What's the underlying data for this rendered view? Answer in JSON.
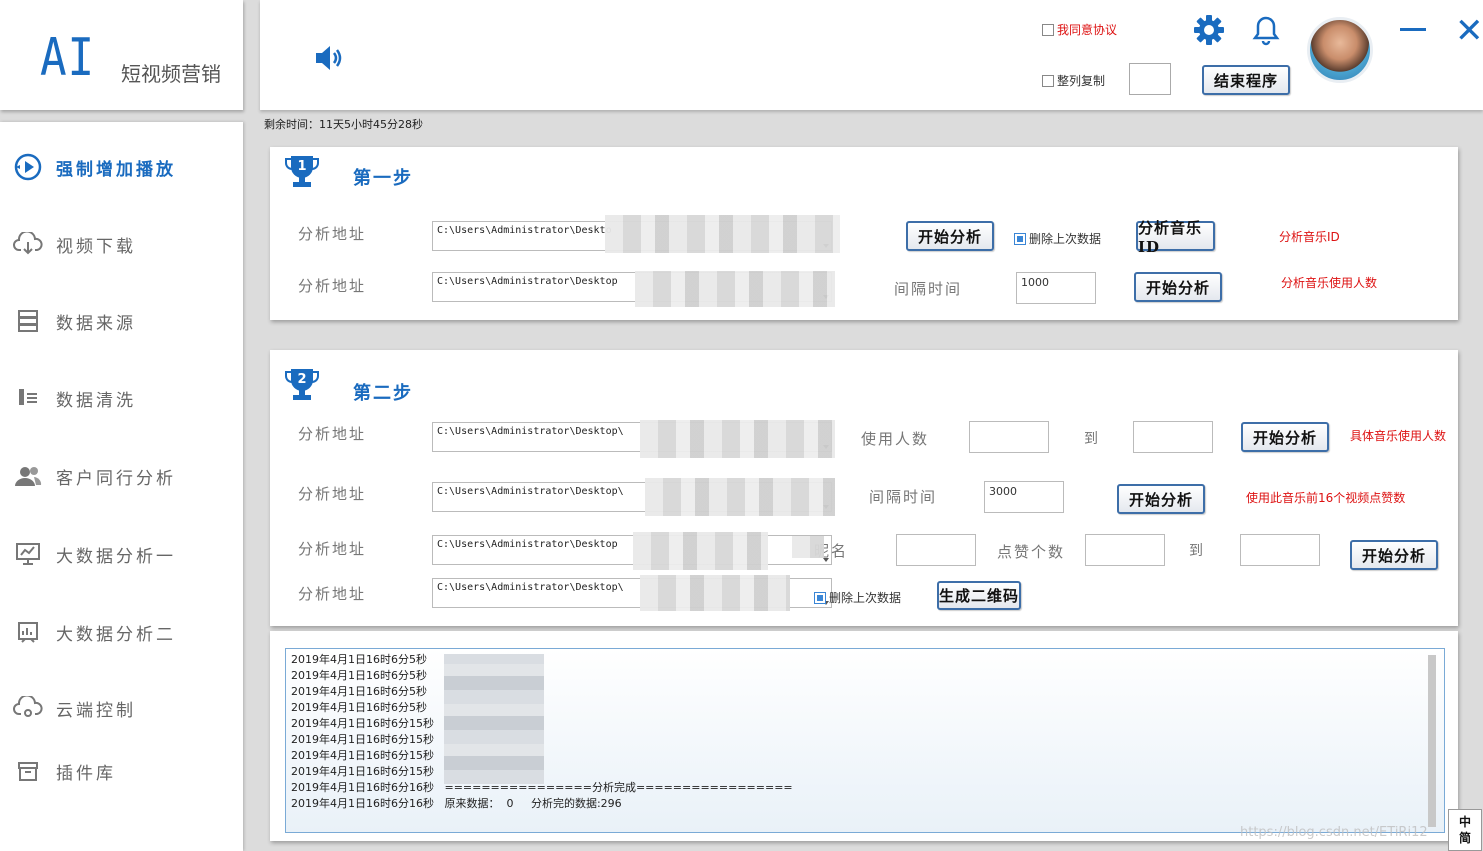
{
  "logo": {
    "ai": "AI",
    "subtitle": "短视频营销"
  },
  "sidebar": {
    "items": [
      {
        "label": "强制增加播放",
        "icon": "play-circle-icon",
        "active": true
      },
      {
        "label": "视频下载",
        "icon": "cloud-download-icon"
      },
      {
        "label": "数据来源",
        "icon": "database-icon"
      },
      {
        "label": "数据清洗",
        "icon": "data-clean-icon"
      },
      {
        "label": "客户同行分析",
        "icon": "users-icon"
      },
      {
        "label": "大数据分析一",
        "icon": "monitor-chart-icon"
      },
      {
        "label": "大数据分析二",
        "icon": "board-chart-icon"
      },
      {
        "label": "云端控制",
        "icon": "cloud-control-icon"
      },
      {
        "label": "插件库",
        "icon": "archive-icon"
      }
    ]
  },
  "header": {
    "agree_label": "我同意协议",
    "copy_label": "整列复制",
    "end_button": "结束程序"
  },
  "remaining_time": "剩余时间：11天5小时45分28秒",
  "step1": {
    "title": "第一步",
    "badge": "1",
    "row1": {
      "label": "分析地址",
      "path": "C:\\Users\\Administrator\\Deskto",
      "btn": "开始分析",
      "delete_label": "删除上次数据",
      "btn2": "分析音乐ID",
      "hint": "分析音乐ID"
    },
    "row2": {
      "label": "分析地址",
      "path": "C:\\Users\\Administrator\\Desktop",
      "interval_label": "间隔时间",
      "interval_value": "1000",
      "btn": "开始分析",
      "hint": "分析音乐使用人数"
    }
  },
  "step2": {
    "title": "第二步",
    "badge": "2",
    "row1": {
      "label": "分析地址",
      "path": "C:\\Users\\Administrator\\Desktop\\",
      "users_label": "使用人数",
      "to": "到",
      "btn": "开始分析",
      "hint": "具体音乐使用人数"
    },
    "row2": {
      "label": "分析地址",
      "path": "C:\\Users\\Administrator\\Desktop\\",
      "interval_label": "间隔时间",
      "interval_value": "3000",
      "btn": "开始分析",
      "hint": "使用此音乐前16个视频点赞数"
    },
    "row3": {
      "label": "分析地址",
      "path": "C:\\Users\\Administrator\\Desktop",
      "name_label": "昵名",
      "likes_label": "点赞个数",
      "to": "到",
      "btn": "开始分析"
    },
    "row4": {
      "label": "分析地址",
      "path": "C:\\Users\\Administrator\\Desktop\\",
      "delete_label": "删除上次数据",
      "btn": "生成二维码"
    }
  },
  "log": {
    "lines": [
      "2019年4月1日16时6分5秒",
      "2019年4月1日16时6分5秒",
      "2019年4月1日16时6分5秒",
      "2019年4月1日16时6分5秒",
      "2019年4月1日16时6分15秒",
      "2019年4月1日16时6分15秒",
      "2019年4月1日16时6分15秒",
      "2019年4月1日16时6分15秒",
      "2019年4月1日16时6分16秒   ================分析完成=================",
      "2019年4月1日16时6分16秒   原来数据：  0     分析完的数据:296"
    ]
  },
  "ime": {
    "top": "中",
    "bottom": "简"
  },
  "watermark": "https://blog.csdn.net/ETiRi12",
  "colors": {
    "accent": "#1a6bbf",
    "hint_red": "#dd1111"
  }
}
